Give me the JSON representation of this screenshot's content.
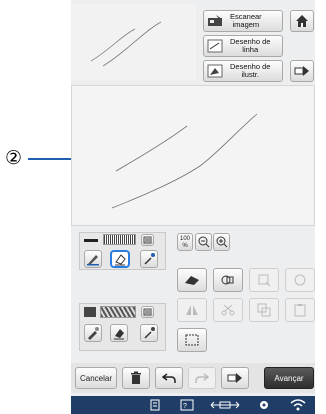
{
  "callout": {
    "number": "②"
  },
  "scan_panel": {
    "scan_label_l1": "Escanear",
    "scan_label_l2": "imagem",
    "line_label_l1": "Desenho de",
    "line_label_l2": "linha",
    "illust_label_l1": "Desenho de",
    "illust_label_l2": "ilustr."
  },
  "zoom": {
    "level": "100",
    "unit": "%"
  },
  "bottom": {
    "cancel_label": "Cancelar",
    "next_label": "Avançar"
  },
  "colors": {
    "accent": "#1f5fb0",
    "status_bar": "#1f3d66",
    "selected_outline": "#2a7de0"
  },
  "icons": [
    "home-icon",
    "scan-icon",
    "line-drawing-icon",
    "illustration-icon",
    "arrow-right-icon",
    "pen-icon",
    "eraser-area-icon",
    "eyedropper-icon",
    "fill-icon",
    "zoom-out-icon",
    "zoom-in-icon",
    "eraser-icon",
    "select-icon",
    "rotate-icon",
    "flip-icon",
    "cut-icon",
    "copy-icon",
    "paste-icon",
    "trash-icon",
    "undo-icon",
    "redo-icon",
    "export-icon",
    "memory-icon",
    "wifi-icon"
  ]
}
